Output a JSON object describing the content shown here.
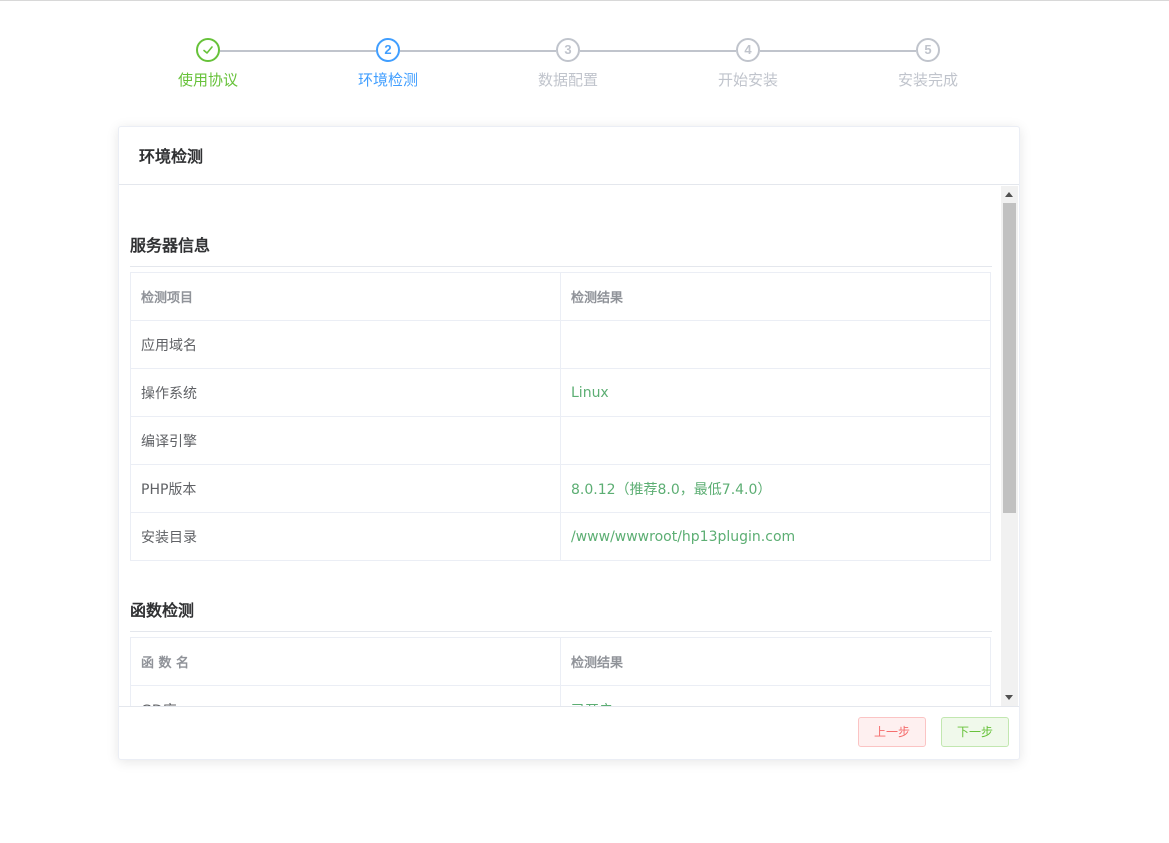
{
  "steps": [
    {
      "number": "",
      "label": "使用协议",
      "state": "done",
      "icon": "check-icon"
    },
    {
      "number": "2",
      "label": "环境检测",
      "state": "active"
    },
    {
      "number": "3",
      "label": "数据配置",
      "state": "pending"
    },
    {
      "number": "4",
      "label": "开始安装",
      "state": "pending"
    },
    {
      "number": "5",
      "label": "安装完成",
      "state": "pending"
    }
  ],
  "card": {
    "title": "环境检测",
    "server_section": {
      "title": "服务器信息",
      "headers": [
        "检测项目",
        "检测结果"
      ],
      "rows": [
        {
          "label": "应用域名",
          "value": ""
        },
        {
          "label": "操作系统",
          "value": "Linux"
        },
        {
          "label": "编译引擎",
          "value": ""
        },
        {
          "label": "PHP版本",
          "value": "8.0.12（推荐8.0，最低7.4.0）"
        },
        {
          "label": "安装目录",
          "value": "/www/wwwroot/hp13plugin.com"
        }
      ]
    },
    "function_section": {
      "title": "函数检测",
      "headers": [
        "函 数 名",
        "检测结果"
      ],
      "rows": [
        {
          "label": "GD库",
          "value": "已开启"
        }
      ]
    },
    "footer": {
      "prev_label": "上一步",
      "next_label": "下一步"
    }
  },
  "colors": {
    "done": "#67c23a",
    "active": "#409eff",
    "pending": "#c0c4cc",
    "ok_value": "#5cae73",
    "danger": "#f56c6c"
  }
}
